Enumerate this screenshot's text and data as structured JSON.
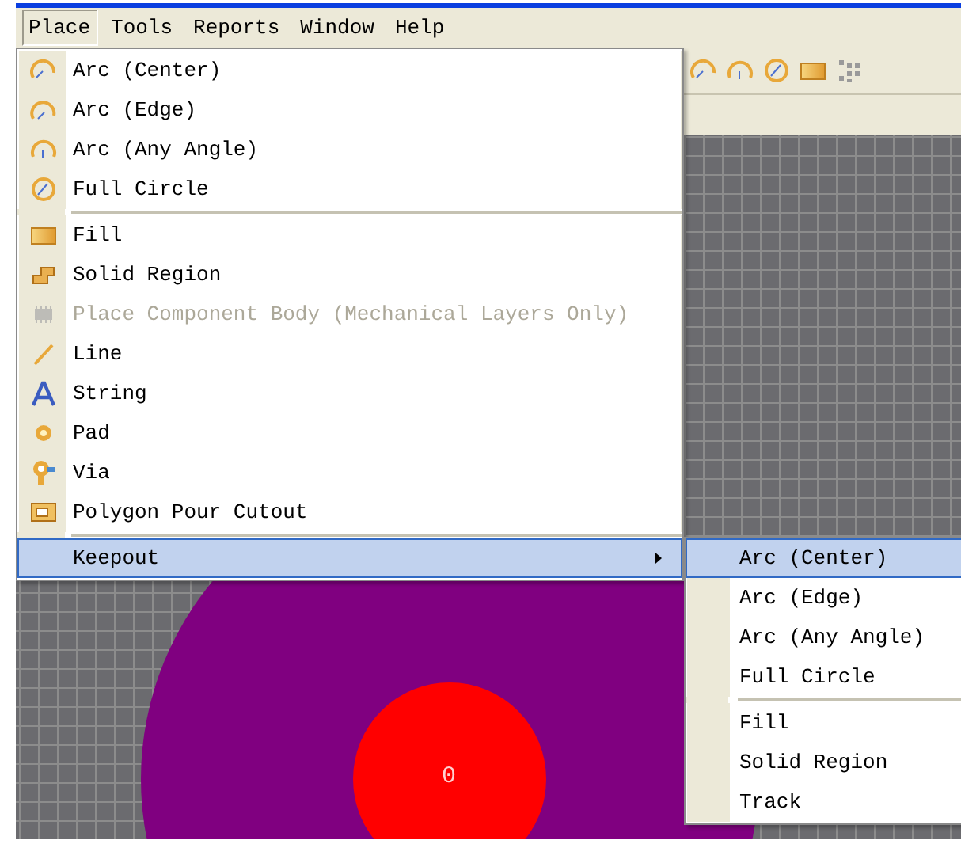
{
  "menubar": [
    {
      "label": "Place",
      "selected": true
    },
    {
      "label": "Tools",
      "selected": false
    },
    {
      "label": "Reports",
      "selected": false
    },
    {
      "label": "Window",
      "selected": false
    },
    {
      "label": "Help",
      "selected": false
    }
  ],
  "place_menu": {
    "groups": [
      [
        {
          "kind": "arc",
          "label": "Arc (Center)",
          "disabled": false,
          "selected": false
        },
        {
          "kind": "edgearc",
          "label": "Arc (Edge)",
          "disabled": false,
          "selected": false
        },
        {
          "kind": "anyarc",
          "label": "Arc (Any Angle)",
          "disabled": false,
          "selected": false
        },
        {
          "kind": "circle",
          "label": "Full Circle",
          "disabled": false,
          "selected": false
        }
      ],
      [
        {
          "kind": "fill",
          "label": "Fill",
          "disabled": false,
          "selected": false
        },
        {
          "kind": "region",
          "label": "Solid Region",
          "disabled": false,
          "selected": false
        },
        {
          "kind": "body",
          "label": "Place Component Body (Mechanical Layers Only)",
          "disabled": true,
          "selected": false
        },
        {
          "kind": "line",
          "label": "Line",
          "disabled": false,
          "selected": false
        },
        {
          "kind": "string",
          "label": "String",
          "disabled": false,
          "selected": false
        },
        {
          "kind": "pad",
          "label": "Pad",
          "disabled": false,
          "selected": false
        },
        {
          "kind": "via",
          "label": "Via",
          "disabled": false,
          "selected": false
        },
        {
          "kind": "cutout",
          "label": "Polygon Pour Cutout",
          "disabled": false,
          "selected": false
        }
      ],
      [
        {
          "kind": "submenu",
          "label": "Keepout",
          "disabled": false,
          "selected": true
        }
      ]
    ]
  },
  "keepout_menu": {
    "groups": [
      [
        {
          "label": "Arc (Center)",
          "selected": true
        },
        {
          "label": "Arc (Edge)",
          "selected": false
        },
        {
          "label": "Arc (Any Angle)",
          "selected": false
        },
        {
          "label": "Full Circle",
          "selected": false
        }
      ],
      [
        {
          "label": "Fill",
          "selected": false
        },
        {
          "label": "Solid Region",
          "selected": false
        },
        {
          "label": "Track",
          "selected": false
        }
      ]
    ]
  },
  "canvas": {
    "pad_label": "0"
  }
}
